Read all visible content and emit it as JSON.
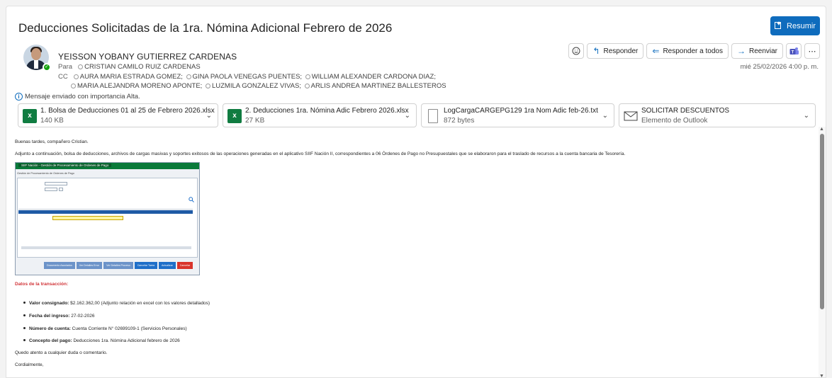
{
  "subject": "Deducciones Solicitadas de la 1ra. Nómina Adicional Febrero de 2026",
  "summarize_button": "Resumir",
  "sender": {
    "name": "YEISSON YOBANY GUTIERREZ CARDENAS",
    "to_label": "Para",
    "to": "CRISTIAN CAMILO RUIZ CARDENAS",
    "cc_label": "CC",
    "cc_line1": [
      "AURA MARIA ESTRADA GOMEZ;",
      "GINA PAOLA VENEGAS PUENTES;",
      "WILLIAM ALEXANDER CARDONA DIAZ;"
    ],
    "cc_line2": [
      "MARIA ALEJANDRA MORENO APONTE;",
      "LUZMILA GONZALEZ VIVAS;",
      "ARLIS ANDREA MARTINEZ BALLESTEROS"
    ]
  },
  "importance": "Mensaje enviado con importancia Alta.",
  "actions": {
    "reply": "Responder",
    "reply_all": "Responder a todos",
    "forward": "Reenviar"
  },
  "date": "mié 25/02/2026 4:00 p. m.",
  "attachments": [
    {
      "name": "1. Bolsa de Deducciones 01 al 25 de Febrero 2026.xlsx",
      "size": "140 KB",
      "type": "excel"
    },
    {
      "name": "2. Deducciones 1ra. Nómina Adic Febrero 2026.xlsx",
      "size": "27 KB",
      "type": "excel"
    },
    {
      "name": "LogCargaCARGEPG129 1ra Nom Adic feb-26.txt",
      "size": "872 bytes",
      "type": "text"
    },
    {
      "name": "SOLICITAR DESCUENTOS",
      "size": "Elemento de Outlook",
      "type": "outlook"
    }
  ],
  "body": {
    "greeting": "Buenas tardes, compañero Cristian.",
    "paragraph": "Adjunto a continuación, bolsa de deducciones, archivos de cargas masivas y soportes exitosos de las operaciones generadas en el aplicativo SIIF Nación II, correspondientes a 06 Órdenes de Pago no Presupuestales que se elaboraron para el traslado de recursos a la cuenta bancaria de Tesorería.",
    "transaction_title": "Datos de la transacción:",
    "items": [
      {
        "label": "Valor consignado:",
        "value": " $2.162.362,00 (Adjunto relación en excel con los valores detallados)"
      },
      {
        "label": "Fecha del ingreso:",
        "value": " 27-02-2026"
      },
      {
        "label": "Número de cuenta:",
        "value": " Cuenta Corriente N° 02699109-1 (Servicios Personales)"
      },
      {
        "label": "Concepto del pago:",
        "value": " Deducciones 1ra. Nómina Adicional febrero de 2026"
      }
    ],
    "closing1": "Quedo atento a cualquier duda o comentario.",
    "closing2": "Cordialmente,"
  },
  "embedded": {
    "header": "SIIF Nación - Gestión de Procesamiento de Ordenes de Pago",
    "sub": "Gestión de Procesamiento de Ordenes de Pago",
    "buttons": [
      "Documento Asociados",
      "Ver Detalles Error",
      "Ver Detalles Proceso",
      "Cancelar Tarea",
      "Actualizar",
      "Cancelar"
    ]
  }
}
